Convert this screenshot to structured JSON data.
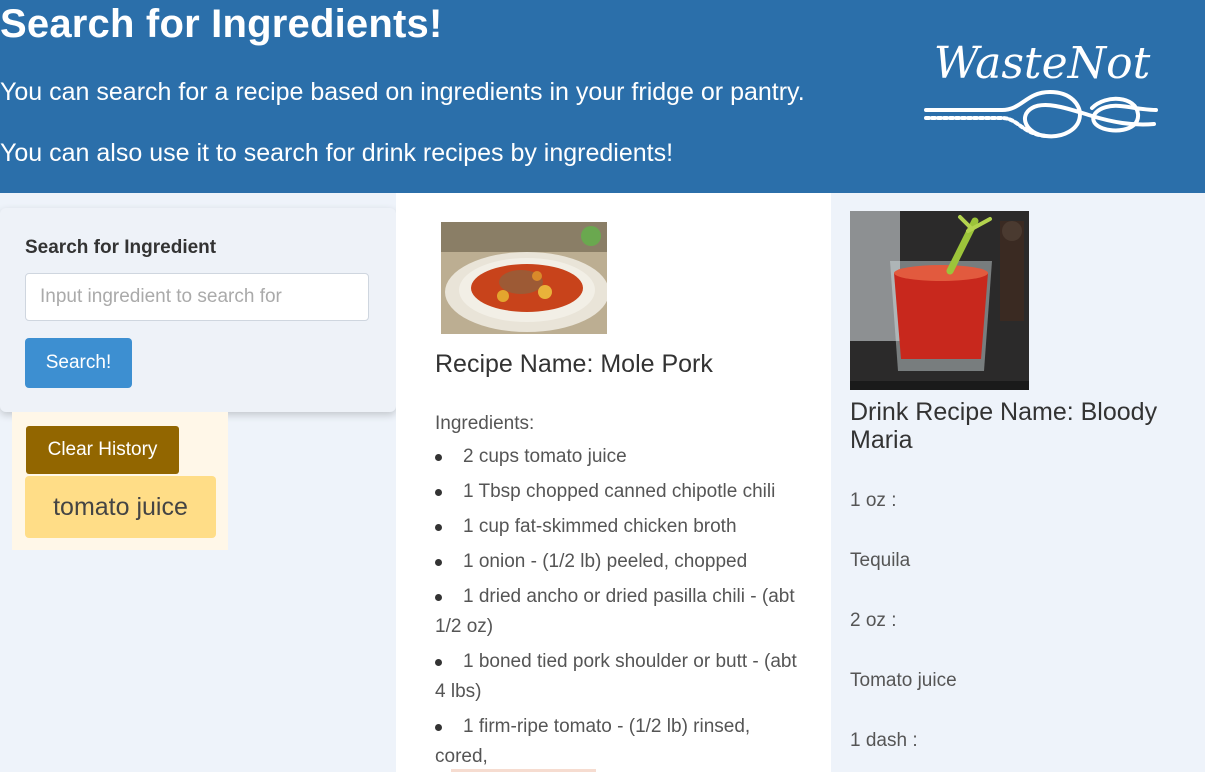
{
  "header": {
    "title": "Search for Ingredients!",
    "line1": "You can search for a recipe based on ingredients in your fridge or pantry.",
    "line2": "You can also use it to search for drink recipes by ingredients!",
    "logo_text": "WasteNot",
    "background_color": "#2b6faa"
  },
  "search": {
    "label": "Search for Ingredient",
    "placeholder": "Input ingredient to search for",
    "value": "",
    "button_label": "Search!"
  },
  "history": {
    "clear_label": "Clear History",
    "items": [
      "tomato juice"
    ]
  },
  "recipe": {
    "image_icon": "food-photo",
    "name": "Recipe Name: Mole Pork",
    "ingredients_label": "Ingredients:",
    "ingredients": [
      "2 cups tomato juice",
      "1 Tbsp chopped canned chipotle chili",
      "1 cup fat-skimmed chicken broth",
      "1 onion - (1/2 lb) peeled, chopped",
      "1 dried ancho or dried pasilla chili - (abt 1/2 oz)",
      "1 boned tied pork shoulder or butt - (abt 4 lbs)",
      "1 firm-ripe tomato - (1/2 lb) rinsed, cored,"
    ]
  },
  "drink": {
    "image_icon": "drink-photo",
    "name": "Drink Recipe Name: Bloody Maria",
    "lines": [
      "1 oz :",
      "Tequila",
      "2 oz :",
      "Tomato juice",
      "1 dash :"
    ]
  }
}
